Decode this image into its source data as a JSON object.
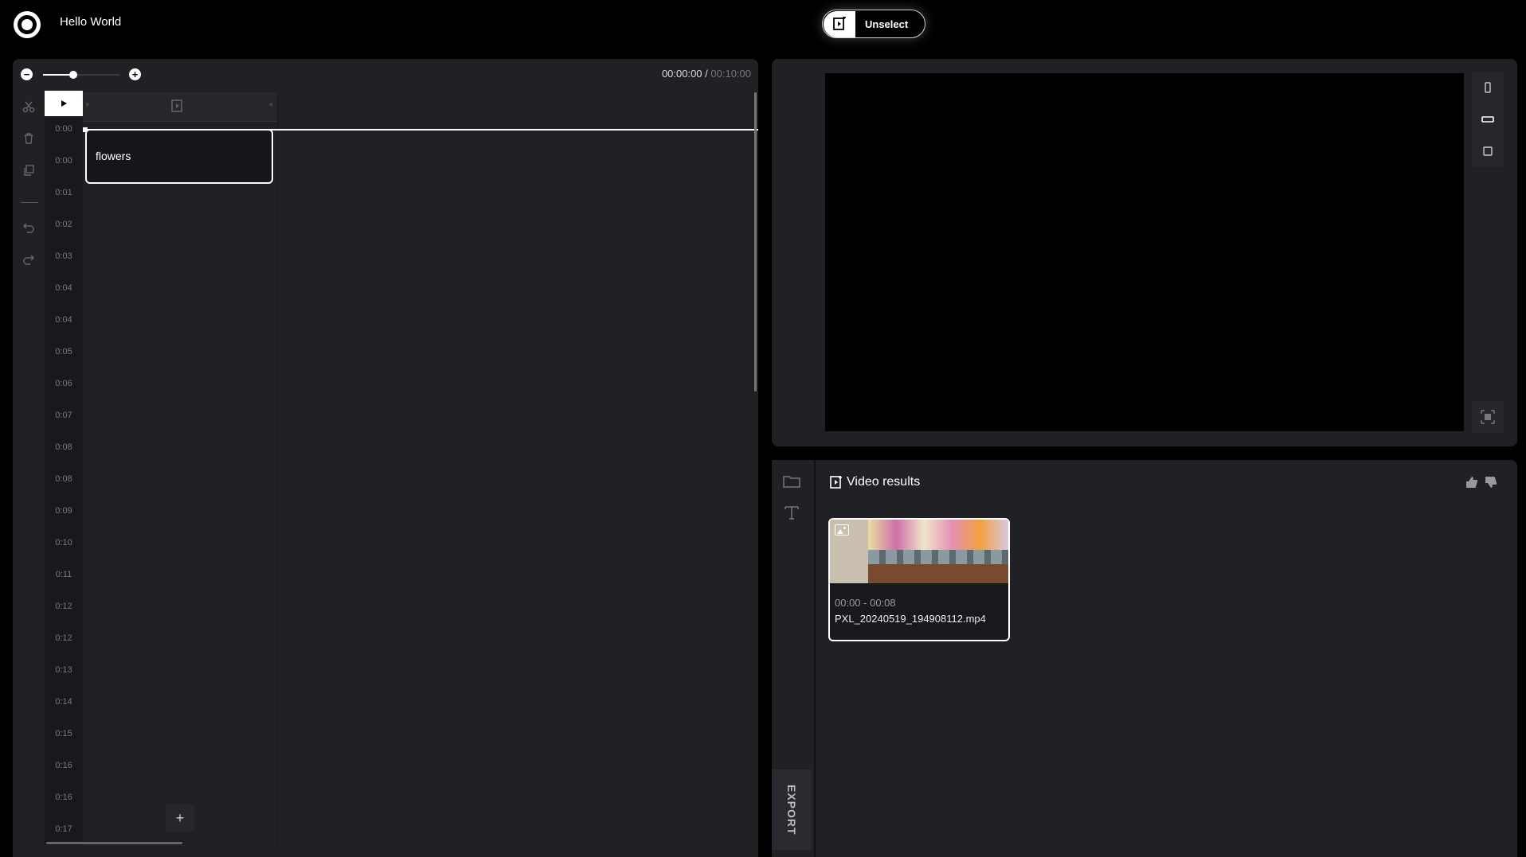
{
  "header": {
    "title": "Hello World",
    "unselect_label": "Unselect"
  },
  "timeline": {
    "current_time": "00:00:00",
    "separator": " / ",
    "total_time": "00:10:00",
    "zoom_level": 0.4,
    "ruler_ticks": [
      "0:00",
      "0:00",
      "0:01",
      "0:02",
      "0:03",
      "0:04",
      "0:04",
      "0:05",
      "0:06",
      "0:07",
      "0:08",
      "0:08",
      "0:09",
      "0:10",
      "0:11",
      "0:12",
      "0:12",
      "0:13",
      "0:14",
      "0:15",
      "0:16",
      "0:16",
      "0:17"
    ],
    "clip_label": "flowers",
    "add_label": "+",
    "tools": [
      "scissors-icon",
      "trash-icon",
      "duplicate-icon",
      "undo-icon",
      "redo-icon"
    ]
  },
  "preview": {
    "aspect_options": [
      "portrait",
      "landscape",
      "square"
    ]
  },
  "results": {
    "title": "Video results",
    "export_label": "EXPORT",
    "items": [
      {
        "range": "00:00 - 00:08",
        "file": "PXL_20240519_194908112.mp4"
      }
    ]
  },
  "colors": {
    "background": "#000000",
    "panel": "#202125",
    "accent": "#ffffff"
  }
}
